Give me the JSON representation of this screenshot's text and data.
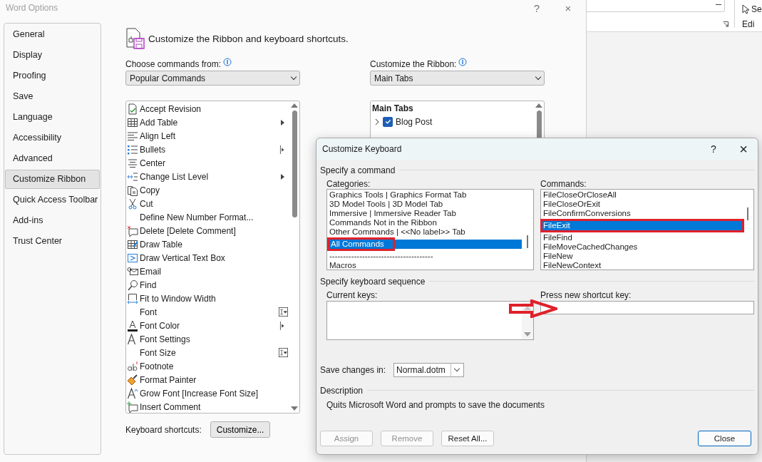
{
  "window": {
    "title": "Word Options",
    "help": "?",
    "close": "×"
  },
  "sidebar": {
    "items": [
      {
        "label": "General",
        "selected": false
      },
      {
        "label": "Display",
        "selected": false
      },
      {
        "label": "Proofing",
        "selected": false
      },
      {
        "label": "Save",
        "selected": false
      },
      {
        "label": "Language",
        "selected": false
      },
      {
        "label": "Accessibility",
        "selected": false
      },
      {
        "label": "Advanced",
        "selected": false
      },
      {
        "label": "Customize Ribbon",
        "selected": true
      },
      {
        "label": "Quick Access Toolbar",
        "selected": false
      },
      {
        "label": "Add-ins",
        "selected": false
      },
      {
        "label": "Trust Center",
        "selected": false
      }
    ]
  },
  "heading": "Customize the Ribbon and keyboard shortcuts.",
  "commands_from": {
    "label": "Choose commands from:",
    "value": "Popular Commands"
  },
  "customize_ribbon": {
    "label": "Customize the Ribbon:",
    "value": "Main Tabs"
  },
  "commands": [
    {
      "label": "Accept Revision",
      "kind": "revision"
    },
    {
      "label": "Add Table",
      "kind": "table",
      "submenu": true
    },
    {
      "label": "Align Left",
      "kind": "align-left"
    },
    {
      "label": "Bullets",
      "kind": "bullets",
      "split": true
    },
    {
      "label": "Center",
      "kind": "center"
    },
    {
      "label": "Change List Level",
      "kind": "list-level",
      "submenu": true
    },
    {
      "label": "Copy",
      "kind": "copy"
    },
    {
      "label": "Cut",
      "kind": "cut"
    },
    {
      "label": "Define New Number Format...",
      "kind": "none"
    },
    {
      "label": "Delete [Delete Comment]",
      "kind": "delete-comment"
    },
    {
      "label": "Draw Table",
      "kind": "draw-table"
    },
    {
      "label": "Draw Vertical Text Box",
      "kind": "text-box"
    },
    {
      "label": "Email",
      "kind": "email"
    },
    {
      "label": "Find",
      "kind": "find"
    },
    {
      "label": "Fit to Window Width",
      "kind": "fit-width"
    },
    {
      "label": "Font",
      "kind": "none",
      "combo": true
    },
    {
      "label": "Font Color",
      "kind": "font-color",
      "split": true
    },
    {
      "label": "Font Settings",
      "kind": "font-settings"
    },
    {
      "label": "Font Size",
      "kind": "none",
      "combo": true
    },
    {
      "label": "Footnote",
      "kind": "footnote"
    },
    {
      "label": "Format Painter",
      "kind": "painter"
    },
    {
      "label": "Grow Font [Increase Font Size]",
      "kind": "grow-font"
    },
    {
      "label": "Insert Comment",
      "kind": "insert-comment"
    }
  ],
  "ribbon_tabs": {
    "header": "Main Tabs",
    "items": [
      {
        "label": "Blog Post",
        "expanded": false,
        "checked": true
      }
    ]
  },
  "keyboard_shortcuts": {
    "label": "Keyboard shortcuts:",
    "button": "Customize..."
  },
  "document_ribbon": {
    "button": "Se",
    "group": "Edi"
  },
  "dialog": {
    "title": "Customize Keyboard",
    "help": "?",
    "close": "×",
    "command_section": "Specify a command",
    "categories": {
      "label": "Categories:",
      "items": [
        {
          "label": "Graphics Tools | Graphics Format Tab",
          "selected": false,
          "highlighted": false
        },
        {
          "label": "3D Model Tools | 3D Model Tab",
          "selected": false,
          "highlighted": false
        },
        {
          "label": "Immersive | Immersive Reader Tab",
          "selected": false,
          "highlighted": false
        },
        {
          "label": "Commands Not in the Ribbon",
          "selected": false,
          "highlighted": false
        },
        {
          "label": "Other Commands | <<No label>> Tab",
          "selected": false,
          "highlighted": false
        },
        {
          "label": "All Commands",
          "selected": true,
          "highlighted": true
        },
        {
          "label": "--------------------------------------",
          "selected": false,
          "highlighted": false
        },
        {
          "label": "Macros",
          "selected": false,
          "highlighted": false
        }
      ]
    },
    "commands": {
      "label": "Commands:",
      "items": [
        {
          "label": "FileCloseOrCloseAll",
          "selected": false,
          "highlighted": false
        },
        {
          "label": "FileCloseOrExit",
          "selected": false,
          "highlighted": false
        },
        {
          "label": "FileConfirmConversions",
          "selected": false,
          "highlighted": false
        },
        {
          "label": "FileExit",
          "selected": true,
          "highlighted": true
        },
        {
          "label": "FileFind",
          "selected": false,
          "highlighted": false
        },
        {
          "label": "FileMoveCachedChanges",
          "selected": false,
          "highlighted": false
        },
        {
          "label": "FileNew",
          "selected": false,
          "highlighted": false
        },
        {
          "label": "FileNewContext",
          "selected": false,
          "highlighted": false
        }
      ]
    },
    "sequence_section": "Specify keyboard sequence",
    "current_keys": {
      "label": "Current keys:"
    },
    "new_key": {
      "label": "Press new shortcut key:",
      "pointed": true
    },
    "save_in": {
      "label": "Save changes in:",
      "value": "Normal.dotm"
    },
    "description_section": "Description",
    "description": "Quits Microsoft Word and prompts to save the documents",
    "buttons": [
      {
        "label": "Assign",
        "disabled": true,
        "default": false
      },
      {
        "label": "Remove",
        "disabled": true,
        "default": false
      },
      {
        "label": "Reset All...",
        "disabled": false,
        "default": false
      },
      {
        "label": "Close",
        "disabled": false,
        "default": true
      }
    ]
  }
}
